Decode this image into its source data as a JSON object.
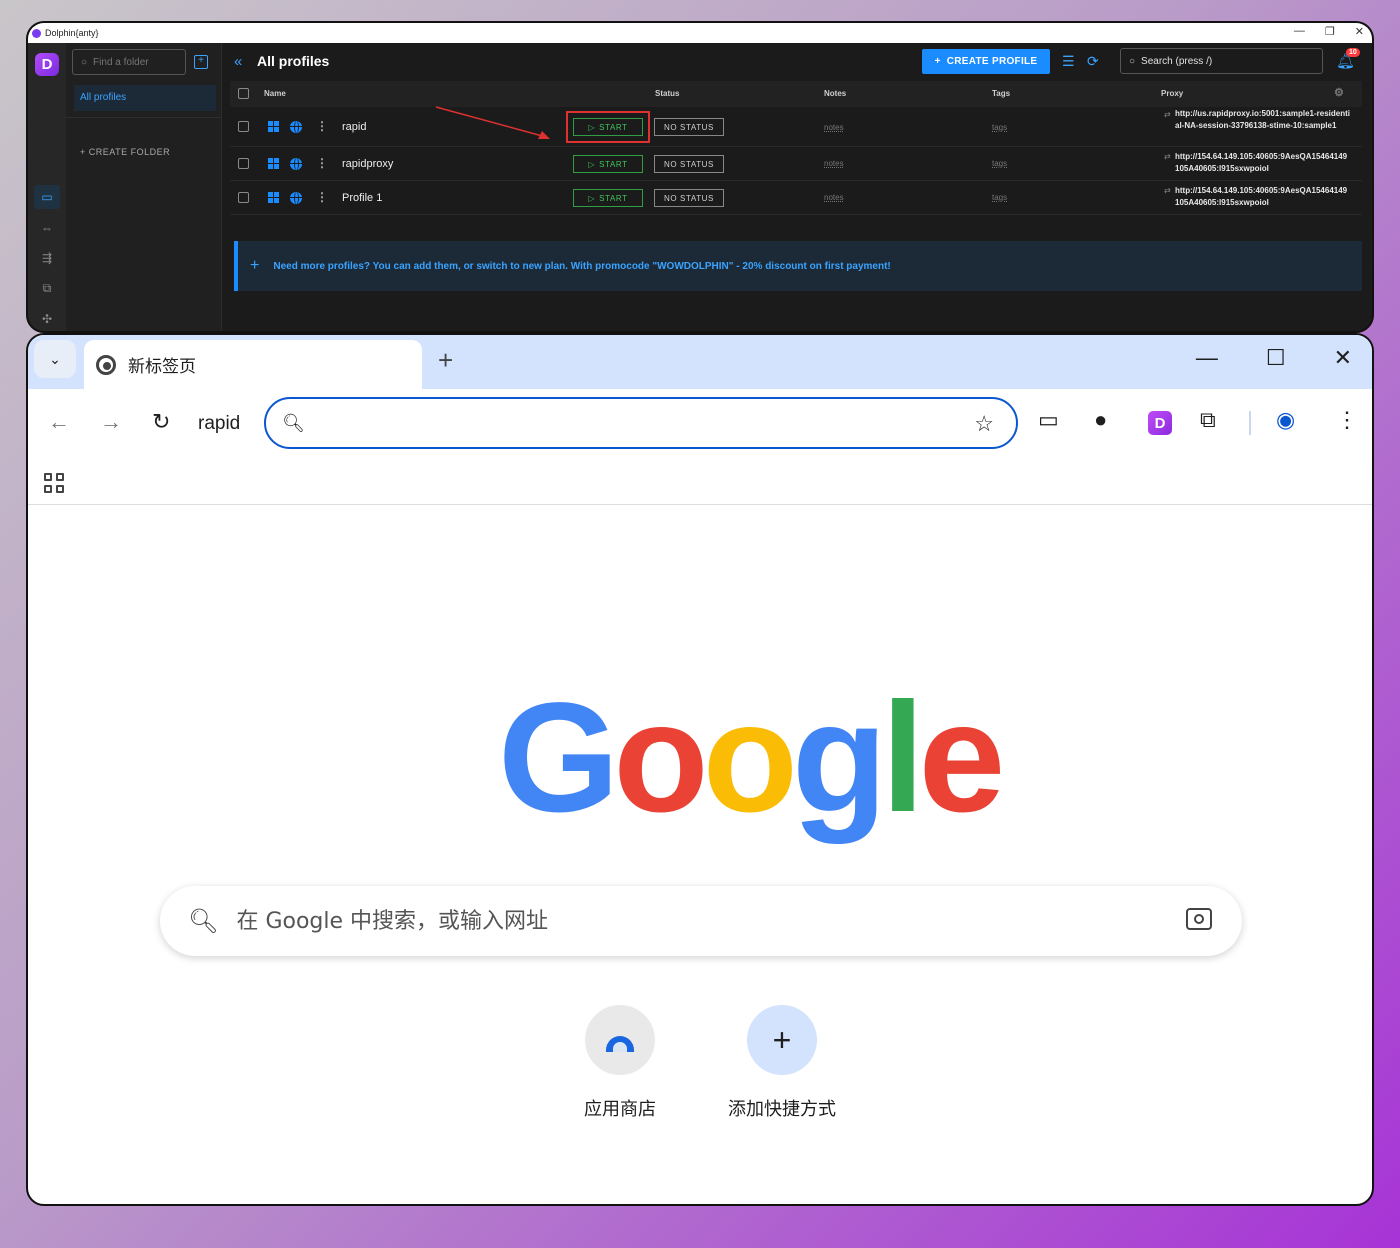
{
  "dolphin": {
    "window_title": "Dolphin{anty}",
    "app_logo": "D",
    "folder_search_placeholder": "Find a folder",
    "folders": [
      "All profiles"
    ],
    "create_folder_label": "+ CREATE FOLDER",
    "page_title": "All profiles",
    "create_profile_label": "CREATE PROFILE",
    "search_placeholder": "Search (press /)",
    "notification_count": "10",
    "columns": [
      "Name",
      "Status",
      "Notes",
      "Tags",
      "Proxy"
    ],
    "start_label": "START",
    "status_label": "NO STATUS",
    "notes_label": "notes",
    "tags_label": "tags",
    "rows": [
      {
        "name": "rapid",
        "proxy": "http://us.rapidproxy.io:5001:sample1-residential-NA-session-33796138-stime-10:sample1"
      },
      {
        "name": "rapidproxy",
        "proxy": "http://154.64.149.105:40605:9AesQA15464149105A40605:l915sxwpoiol"
      },
      {
        "name": "Profile 1",
        "proxy": "http://154.64.149.105:40605:9AesQA15464149105A40605:l915sxwpoiol"
      }
    ],
    "promo": "Need more profiles? You can add them, or switch to new plan. With promocode \"WOWDOLPHIN\" - 20% discount on first payment!"
  },
  "chrome": {
    "tab_title": "新标签页",
    "profile_name": "rapid",
    "omnibox_value": "",
    "google_search_placeholder": "在 Google 中搜索，或输入网址",
    "shortcuts": [
      {
        "label": "应用商店"
      },
      {
        "label": "添加快捷方式"
      }
    ],
    "logo_letters": [
      "G",
      "o",
      "o",
      "g",
      "l",
      "e"
    ]
  }
}
